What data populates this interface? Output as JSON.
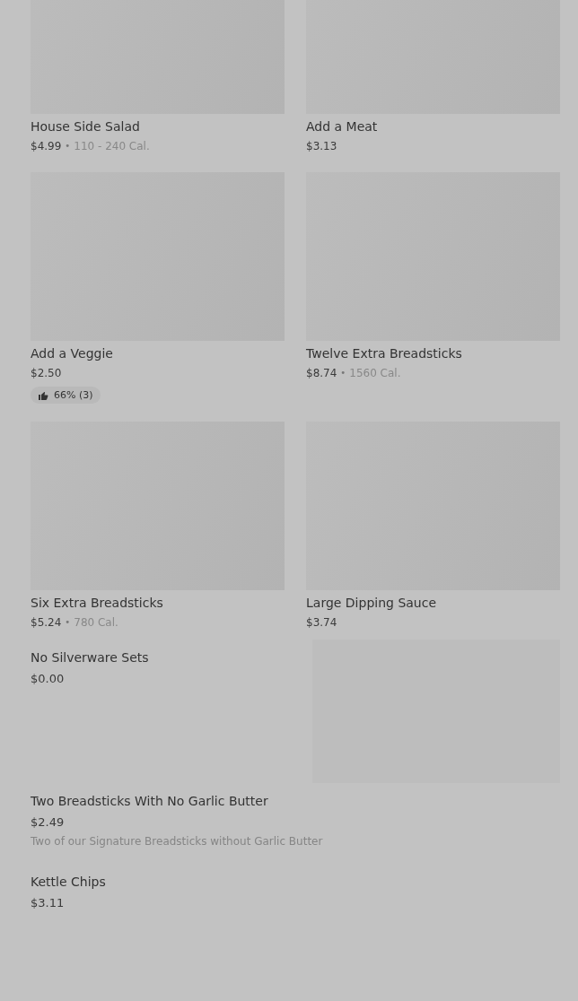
{
  "grid_items": [
    {
      "name": "House Side Salad",
      "price": "$4.99",
      "separator": "•",
      "calories": "110 - 240 Cal."
    },
    {
      "name": "Add a Meat",
      "price": "$3.13"
    },
    {
      "name": "Add a Veggie",
      "price": "$2.50",
      "rating": "66% (3)"
    },
    {
      "name": "Twelve Extra Breadsticks",
      "price": "$8.74",
      "separator": "•",
      "calories": "1560 Cal."
    },
    {
      "name": "Six Extra Breadsticks",
      "price": "$5.24",
      "separator": "•",
      "calories": "780 Cal."
    },
    {
      "name": "Large Dipping Sauce",
      "price": "$3.74"
    }
  ],
  "list_items": [
    {
      "name": "No Silverware Sets",
      "price": "$0.00",
      "image": true
    },
    {
      "name": "Two Breadsticks With No Garlic Butter",
      "price": "$2.49",
      "description": "Two of our Signature Breadsticks without Garlic Butter",
      "image": false
    },
    {
      "name": "Kettle Chips",
      "price": "$3.11",
      "image": false
    }
  ]
}
